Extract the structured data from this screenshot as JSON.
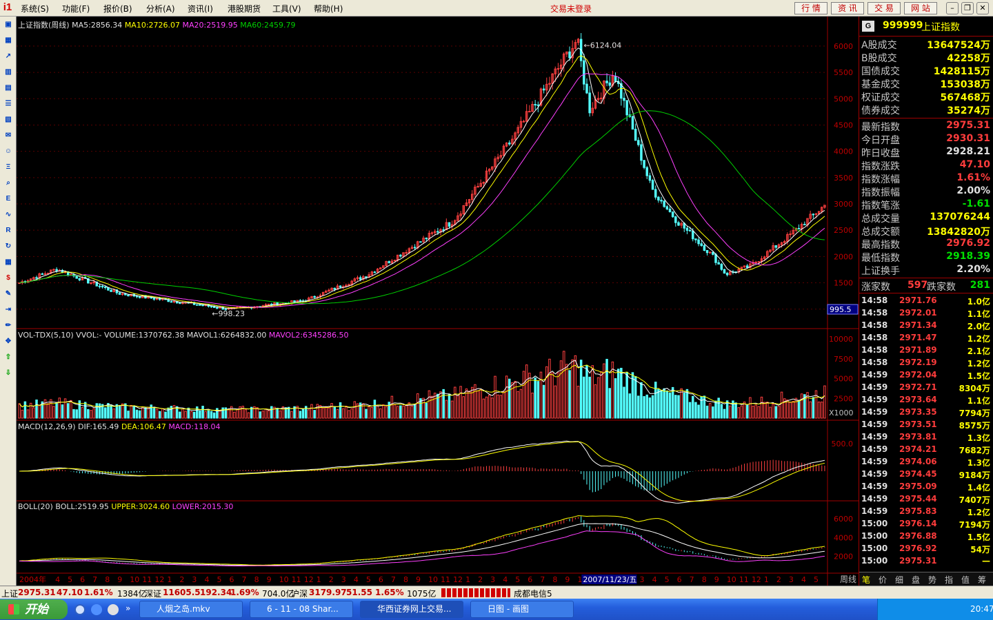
{
  "menu": {
    "logo": "i1",
    "items": [
      "系统(S)",
      "功能(F)",
      "报价(B)",
      "分析(A)",
      "资讯(I)",
      "港股期货",
      "工具(V)",
      "帮助(H)"
    ],
    "login_status": "交易未登录",
    "right_buttons": [
      "行 情",
      "资 讯",
      "交 易",
      "网 站"
    ]
  },
  "toolbar_icons": [
    "pin-icon",
    "grid-icon",
    "line-chart-icon",
    "candle-icon",
    "window-icon",
    "list-icon",
    "report-icon",
    "mail-icon",
    "people-icon",
    "fund-icon",
    "search-icon",
    "etf-icon",
    "wave-icon",
    "rsi-icon",
    "refresh-icon",
    "table-icon",
    "dollar-icon",
    "tool-icon",
    "export-icon",
    "pencil-icon",
    "move-icon",
    "up-arrow-icon",
    "down-arrow-icon"
  ],
  "main_panel": {
    "title": "上证指数(周线)",
    "ma5": "MA5:2856.34",
    "ma10": "MA10:2726.07",
    "ma20": "MA20:2519.95",
    "ma60": "MA60:2459.79",
    "peak_label": "6124.04",
    "low_label": "998.23",
    "y_ticks": [
      "6000",
      "5500",
      "5000",
      "4500",
      "4000",
      "3500",
      "3000",
      "2500",
      "2000",
      "1500",
      "1000"
    ],
    "cursor_value": "995.5"
  },
  "vol_panel": {
    "title": "VOL-TDX(5,10) VVOL:-",
    "volume": "VOLUME:1370762.38",
    "mavol1": "MAVOL1:6264832.00",
    "mavol2": "MAVOL2:6345286.50",
    "y_ticks": [
      "10000",
      "7500",
      "5000",
      "2500"
    ],
    "unit": "X1000"
  },
  "macd_panel": {
    "title": "MACD(12,26,9)",
    "dif": "DIF:165.49",
    "dea": "DEA:106.47",
    "macd": "MACD:118.04",
    "y_ticks": [
      "500.0"
    ]
  },
  "boll_panel": {
    "title": "BOLL(20)",
    "boll": "BOLL:2519.95",
    "upper": "UPPER:3024.60",
    "lower": "LOWER:2015.30",
    "y_ticks": [
      "6000",
      "4000",
      "2000"
    ]
  },
  "x_axis": {
    "year": "2004年",
    "months": [
      "2",
      "3",
      "4",
      "5",
      "6",
      "7",
      "8",
      "9",
      "10",
      "11",
      "12",
      "1",
      "2",
      "3",
      "4",
      "5",
      "6",
      "7",
      "8",
      "9",
      "10",
      "11",
      "12",
      "1",
      "2",
      "3",
      "4",
      "5",
      "6",
      "7",
      "8",
      "9",
      "10",
      "11",
      "12",
      "1",
      "2",
      "3",
      "4",
      "5",
      "6",
      "7",
      "8",
      "9",
      "10",
      "11",
      "12",
      "1",
      "2",
      "3",
      "4",
      "5",
      "6",
      "7",
      "8",
      "9",
      "10",
      "11",
      "12",
      "1",
      "2",
      "3",
      "4",
      "5",
      "6"
    ],
    "cursor_date": "2007/11/23/五",
    "period": "周线"
  },
  "quote": {
    "code": "999999",
    "name": "上证指数",
    "badge": "G",
    "turnover": [
      {
        "label": "A股成交",
        "value": "13647524万"
      },
      {
        "label": "B股成交",
        "value": "42258万"
      },
      {
        "label": "国债成交",
        "value": "1428115万"
      },
      {
        "label": "基金成交",
        "value": "153038万"
      },
      {
        "label": "权证成交",
        "value": "567468万"
      },
      {
        "label": "债券成交",
        "value": "35274万"
      }
    ],
    "stats": [
      {
        "label": "最新指数",
        "value": "2975.31",
        "color": "#ff3c3c"
      },
      {
        "label": "今日开盘",
        "value": "2930.31",
        "color": "#ff3c3c"
      },
      {
        "label": "昨日收盘",
        "value": "2928.21",
        "color": "#e0e0e0"
      },
      {
        "label": "指数涨跌",
        "value": "47.10",
        "color": "#ff3c3c"
      },
      {
        "label": "指数涨幅",
        "value": "1.61%",
        "color": "#ff3c3c"
      },
      {
        "label": "指数振幅",
        "value": "2.00%",
        "color": "#e0e0e0"
      },
      {
        "label": "指数笔涨",
        "value": "-1.61",
        "color": "#00e000"
      },
      {
        "label": "总成交量",
        "value": "137076244",
        "color": "#ffff00"
      },
      {
        "label": "总成交额",
        "value": "13842820万",
        "color": "#ffff00"
      },
      {
        "label": "最高指数",
        "value": "2976.92",
        "color": "#ff3c3c"
      },
      {
        "label": "最低指数",
        "value": "2918.39",
        "color": "#00e000"
      },
      {
        "label": "上证换手",
        "value": "2.20%",
        "color": "#e0e0e0"
      }
    ],
    "rise_label": "涨家数",
    "rise_count": "597",
    "fall_label": "跌家数",
    "fall_count": "281"
  },
  "ticks": [
    {
      "time": "14:58",
      "price": "2971.76",
      "vol": "1.0亿"
    },
    {
      "time": "14:58",
      "price": "2972.01",
      "vol": "1.1亿"
    },
    {
      "time": "14:58",
      "price": "2971.34",
      "vol": "2.0亿"
    },
    {
      "time": "14:58",
      "price": "2971.47",
      "vol": "1.2亿"
    },
    {
      "time": "14:58",
      "price": "2971.89",
      "vol": "2.1亿"
    },
    {
      "time": "14:58",
      "price": "2972.19",
      "vol": "1.2亿"
    },
    {
      "time": "14:59",
      "price": "2972.04",
      "vol": "1.5亿"
    },
    {
      "time": "14:59",
      "price": "2972.71",
      "vol": "8304万"
    },
    {
      "time": "14:59",
      "price": "2973.64",
      "vol": "1.1亿"
    },
    {
      "time": "14:59",
      "price": "2973.35",
      "vol": "7794万"
    },
    {
      "time": "14:59",
      "price": "2973.51",
      "vol": "8575万"
    },
    {
      "time": "14:59",
      "price": "2973.81",
      "vol": "1.3亿"
    },
    {
      "time": "14:59",
      "price": "2974.21",
      "vol": "7682万"
    },
    {
      "time": "14:59",
      "price": "2974.06",
      "vol": "1.3亿"
    },
    {
      "time": "14:59",
      "price": "2974.45",
      "vol": "9184万"
    },
    {
      "time": "14:59",
      "price": "2975.09",
      "vol": "1.4亿"
    },
    {
      "time": "14:59",
      "price": "2975.44",
      "vol": "7407万"
    },
    {
      "time": "14:59",
      "price": "2975.83",
      "vol": "1.2亿"
    },
    {
      "time": "15:00",
      "price": "2976.14",
      "vol": "7194万"
    },
    {
      "time": "15:00",
      "price": "2976.88",
      "vol": "1.5亿"
    },
    {
      "time": "15:00",
      "price": "2976.92",
      "vol": "54万"
    },
    {
      "time": "15:00",
      "price": "2975.31",
      "vol": "—"
    }
  ],
  "bottom_tabs": [
    "笔",
    "价",
    "细",
    "盘",
    "势",
    "指",
    "值",
    "筹"
  ],
  "status": {
    "sh_label": "上证",
    "sh_value": "2975.31",
    "sh_change": "47.10",
    "sh_pct": "1.61%",
    "sh_amount": "1384亿",
    "sz_label": "深证",
    "sz_value": "11605.5",
    "sz_change": "192.34",
    "sz_pct": "1.69%",
    "sz_amount": "704.0亿",
    "hs_label": "沪深",
    "hs_value": "3179.97",
    "hs_change": "51.55",
    "hs_pct": "1.65%",
    "hs_amount": "1075亿",
    "server": "成都电信5"
  },
  "taskbar": {
    "start": "开始",
    "tasks": [
      "人烟之岛.mkv",
      "6 - 11 - 08 Shar...",
      "华西证券网上交易...",
      "日图 - 画图"
    ],
    "clock": "20:47"
  },
  "chart_data": {
    "type": "candlestick",
    "title": "上证指数(周线)",
    "x_range": [
      "2004-01",
      "2009-06"
    ],
    "ylim": [
      800,
      6300
    ],
    "anchors": [
      {
        "date": "2004-01",
        "close": 1500
      },
      {
        "date": "2004-04",
        "close": 1760
      },
      {
        "date": "2004-09",
        "close": 1300
      },
      {
        "date": "2005-06",
        "close": 998.23
      },
      {
        "date": "2005-12",
        "close": 1160
      },
      {
        "date": "2006-05",
        "close": 1640
      },
      {
        "date": "2006-12",
        "close": 2675
      },
      {
        "date": "2007-05",
        "close": 4300
      },
      {
        "date": "2007-10",
        "close": 6124.04
      },
      {
        "date": "2007-11",
        "close": 4800
      },
      {
        "date": "2008-01",
        "close": 5500
      },
      {
        "date": "2008-04",
        "close": 3300
      },
      {
        "date": "2008-06",
        "close": 2700
      },
      {
        "date": "2008-09",
        "close": 2000
      },
      {
        "date": "2008-10",
        "close": 1664
      },
      {
        "date": "2008-12",
        "close": 1820
      },
      {
        "date": "2009-03",
        "close": 2370
      },
      {
        "date": "2009-06",
        "close": 2975.31
      }
    ],
    "ma": {
      "MA5": 2856.34,
      "MA10": 2726.07,
      "MA20": 2519.95,
      "MA60": 2459.79
    },
    "volume": {
      "VOLUME": 1370762.38,
      "MAVOL1": 6264832.0,
      "MAVOL2": 6345286.5,
      "ylim": [
        0,
        10000
      ],
      "unit": "X1000"
    },
    "macd": {
      "DIF": 165.49,
      "DEA": 106.47,
      "MACD": 118.04
    },
    "boll": {
      "BOLL": 2519.95,
      "UPPER": 3024.6,
      "LOWER": 2015.3
    }
  }
}
